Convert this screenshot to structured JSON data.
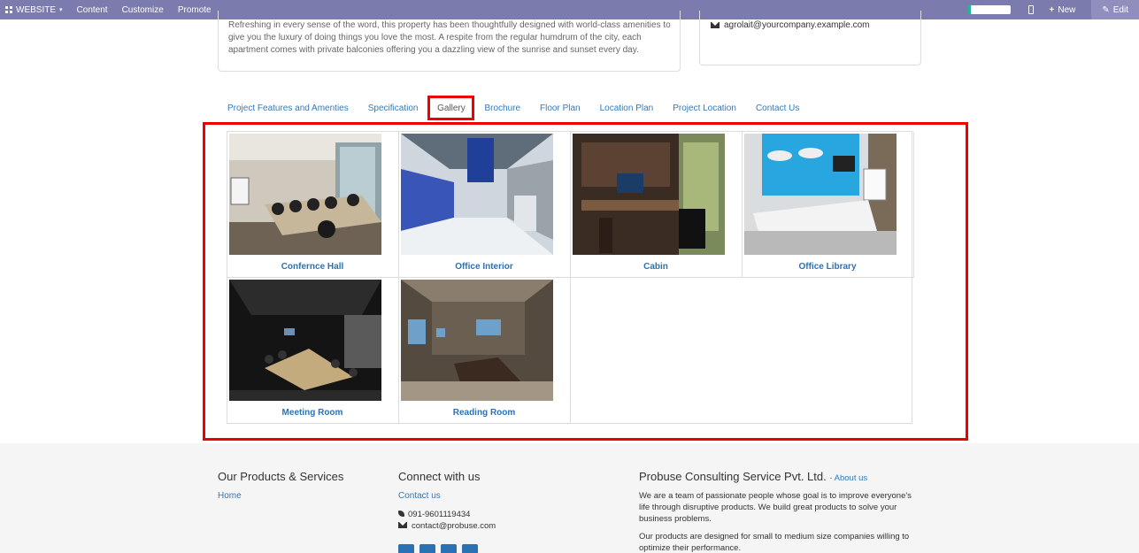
{
  "topbar": {
    "brand": "WEBSITE",
    "menu": [
      "Content",
      "Customize",
      "Promote"
    ],
    "new_label": "New",
    "edit_label": "Edit"
  },
  "intro_text": "Refreshing in every sense of the word, this property has been thoughtfully designed with world-class amenities to give you the luxury of doing things you love the most. A respite from the regular humdrum of the city, each apartment comes with private balconies offering you a dazzling view of the sunrise and sunset every day.",
  "contact_email": "agrolait@yourcompany.example.com",
  "tabs": [
    {
      "label": "Project Features and Amenties"
    },
    {
      "label": "Specification"
    },
    {
      "label": "Gallery"
    },
    {
      "label": "Brochure"
    },
    {
      "label": "Floor Plan"
    },
    {
      "label": "Location Plan"
    },
    {
      "label": "Project Location"
    },
    {
      "label": "Contact Us"
    }
  ],
  "gallery": [
    {
      "caption": "Confernce Hall"
    },
    {
      "caption": "Office Interior"
    },
    {
      "caption": "Cabin"
    },
    {
      "caption": "Office Library"
    },
    {
      "caption": "Meeting Room"
    },
    {
      "caption": "Reading Room"
    }
  ],
  "footer": {
    "products_title": "Our Products & Services",
    "products_link": "Home",
    "connect_title": "Connect with us",
    "connect_link": "Contact us",
    "phone": "091-9601119434",
    "email": "contact@probuse.com",
    "company_title": "Probuse Consulting Service Pvt. Ltd.",
    "about_link": "- About us",
    "about_p1": "We are a team of passionate people whose goal is to improve everyone's life through disruptive products. We build great products to solve your business problems.",
    "about_p2": "Our products are designed for small to medium size companies willing to optimize their performance."
  },
  "colors": {
    "topbar": "#7c7bad",
    "link": "#337ab7",
    "highlight": "#e00000"
  }
}
